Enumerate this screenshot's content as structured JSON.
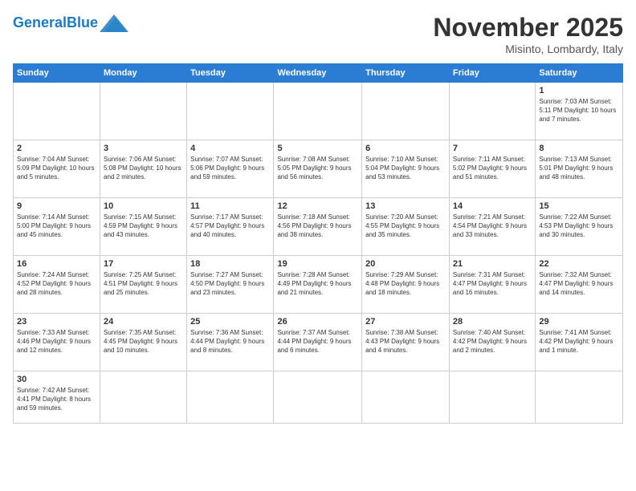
{
  "header": {
    "logo_general": "General",
    "logo_blue": "Blue",
    "month_title": "November 2025",
    "location": "Misinto, Lombardy, Italy"
  },
  "days_of_week": [
    "Sunday",
    "Monday",
    "Tuesday",
    "Wednesday",
    "Thursday",
    "Friday",
    "Saturday"
  ],
  "weeks": [
    [
      {
        "day": "",
        "info": ""
      },
      {
        "day": "",
        "info": ""
      },
      {
        "day": "",
        "info": ""
      },
      {
        "day": "",
        "info": ""
      },
      {
        "day": "",
        "info": ""
      },
      {
        "day": "",
        "info": ""
      },
      {
        "day": "1",
        "info": "Sunrise: 7:03 AM\nSunset: 5:11 PM\nDaylight: 10 hours and 7 minutes."
      }
    ],
    [
      {
        "day": "2",
        "info": "Sunrise: 7:04 AM\nSunset: 5:09 PM\nDaylight: 10 hours and 5 minutes."
      },
      {
        "day": "3",
        "info": "Sunrise: 7:06 AM\nSunset: 5:08 PM\nDaylight: 10 hours and 2 minutes."
      },
      {
        "day": "4",
        "info": "Sunrise: 7:07 AM\nSunset: 5:06 PM\nDaylight: 9 hours and 59 minutes."
      },
      {
        "day": "5",
        "info": "Sunrise: 7:08 AM\nSunset: 5:05 PM\nDaylight: 9 hours and 56 minutes."
      },
      {
        "day": "6",
        "info": "Sunrise: 7:10 AM\nSunset: 5:04 PM\nDaylight: 9 hours and 53 minutes."
      },
      {
        "day": "7",
        "info": "Sunrise: 7:11 AM\nSunset: 5:02 PM\nDaylight: 9 hours and 51 minutes."
      },
      {
        "day": "8",
        "info": "Sunrise: 7:13 AM\nSunset: 5:01 PM\nDaylight: 9 hours and 48 minutes."
      }
    ],
    [
      {
        "day": "9",
        "info": "Sunrise: 7:14 AM\nSunset: 5:00 PM\nDaylight: 9 hours and 45 minutes."
      },
      {
        "day": "10",
        "info": "Sunrise: 7:15 AM\nSunset: 4:59 PM\nDaylight: 9 hours and 43 minutes."
      },
      {
        "day": "11",
        "info": "Sunrise: 7:17 AM\nSunset: 4:57 PM\nDaylight: 9 hours and 40 minutes."
      },
      {
        "day": "12",
        "info": "Sunrise: 7:18 AM\nSunset: 4:56 PM\nDaylight: 9 hours and 38 minutes."
      },
      {
        "day": "13",
        "info": "Sunrise: 7:20 AM\nSunset: 4:55 PM\nDaylight: 9 hours and 35 minutes."
      },
      {
        "day": "14",
        "info": "Sunrise: 7:21 AM\nSunset: 4:54 PM\nDaylight: 9 hours and 33 minutes."
      },
      {
        "day": "15",
        "info": "Sunrise: 7:22 AM\nSunset: 4:53 PM\nDaylight: 9 hours and 30 minutes."
      }
    ],
    [
      {
        "day": "16",
        "info": "Sunrise: 7:24 AM\nSunset: 4:52 PM\nDaylight: 9 hours and 28 minutes."
      },
      {
        "day": "17",
        "info": "Sunrise: 7:25 AM\nSunset: 4:51 PM\nDaylight: 9 hours and 25 minutes."
      },
      {
        "day": "18",
        "info": "Sunrise: 7:27 AM\nSunset: 4:50 PM\nDaylight: 9 hours and 23 minutes."
      },
      {
        "day": "19",
        "info": "Sunrise: 7:28 AM\nSunset: 4:49 PM\nDaylight: 9 hours and 21 minutes."
      },
      {
        "day": "20",
        "info": "Sunrise: 7:29 AM\nSunset: 4:48 PM\nDaylight: 9 hours and 18 minutes."
      },
      {
        "day": "21",
        "info": "Sunrise: 7:31 AM\nSunset: 4:47 PM\nDaylight: 9 hours and 16 minutes."
      },
      {
        "day": "22",
        "info": "Sunrise: 7:32 AM\nSunset: 4:47 PM\nDaylight: 9 hours and 14 minutes."
      }
    ],
    [
      {
        "day": "23",
        "info": "Sunrise: 7:33 AM\nSunset: 4:46 PM\nDaylight: 9 hours and 12 minutes."
      },
      {
        "day": "24",
        "info": "Sunrise: 7:35 AM\nSunset: 4:45 PM\nDaylight: 9 hours and 10 minutes."
      },
      {
        "day": "25",
        "info": "Sunrise: 7:36 AM\nSunset: 4:44 PM\nDaylight: 9 hours and 8 minutes."
      },
      {
        "day": "26",
        "info": "Sunrise: 7:37 AM\nSunset: 4:44 PM\nDaylight: 9 hours and 6 minutes."
      },
      {
        "day": "27",
        "info": "Sunrise: 7:38 AM\nSunset: 4:43 PM\nDaylight: 9 hours and 4 minutes."
      },
      {
        "day": "28",
        "info": "Sunrise: 7:40 AM\nSunset: 4:42 PM\nDaylight: 9 hours and 2 minutes."
      },
      {
        "day": "29",
        "info": "Sunrise: 7:41 AM\nSunset: 4:42 PM\nDaylight: 9 hours and 1 minute."
      }
    ],
    [
      {
        "day": "30",
        "info": "Sunrise: 7:42 AM\nSunset: 4:41 PM\nDaylight: 8 hours and 59 minutes."
      },
      {
        "day": "",
        "info": ""
      },
      {
        "day": "",
        "info": ""
      },
      {
        "day": "",
        "info": ""
      },
      {
        "day": "",
        "info": ""
      },
      {
        "day": "",
        "info": ""
      },
      {
        "day": "",
        "info": ""
      }
    ]
  ]
}
